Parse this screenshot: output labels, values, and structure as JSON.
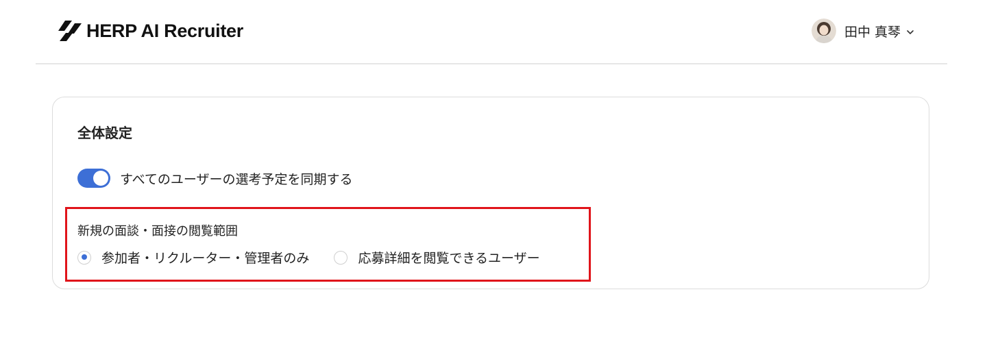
{
  "header": {
    "app_name": "HERP AI Recruiter",
    "user_name": "田中 真琴",
    "icons": {
      "logo": "herp-logo-icon",
      "avatar": "avatar",
      "menu": "chevron-down-icon"
    }
  },
  "settings": {
    "title": "全体設定",
    "sync_toggle": {
      "label": "すべてのユーザーの選考予定を同期する",
      "on": true
    },
    "visibility": {
      "label": "新規の面談・面接の閲覧範囲",
      "options": [
        {
          "label": "参加者・リクルーター・管理者のみ",
          "selected": true
        },
        {
          "label": "応募詳細を閲覧できるユーザー",
          "selected": false
        }
      ]
    }
  },
  "colors": {
    "accent": "#3d6fd6",
    "highlight": "#e0141a",
    "border": "#dcdcdc"
  }
}
